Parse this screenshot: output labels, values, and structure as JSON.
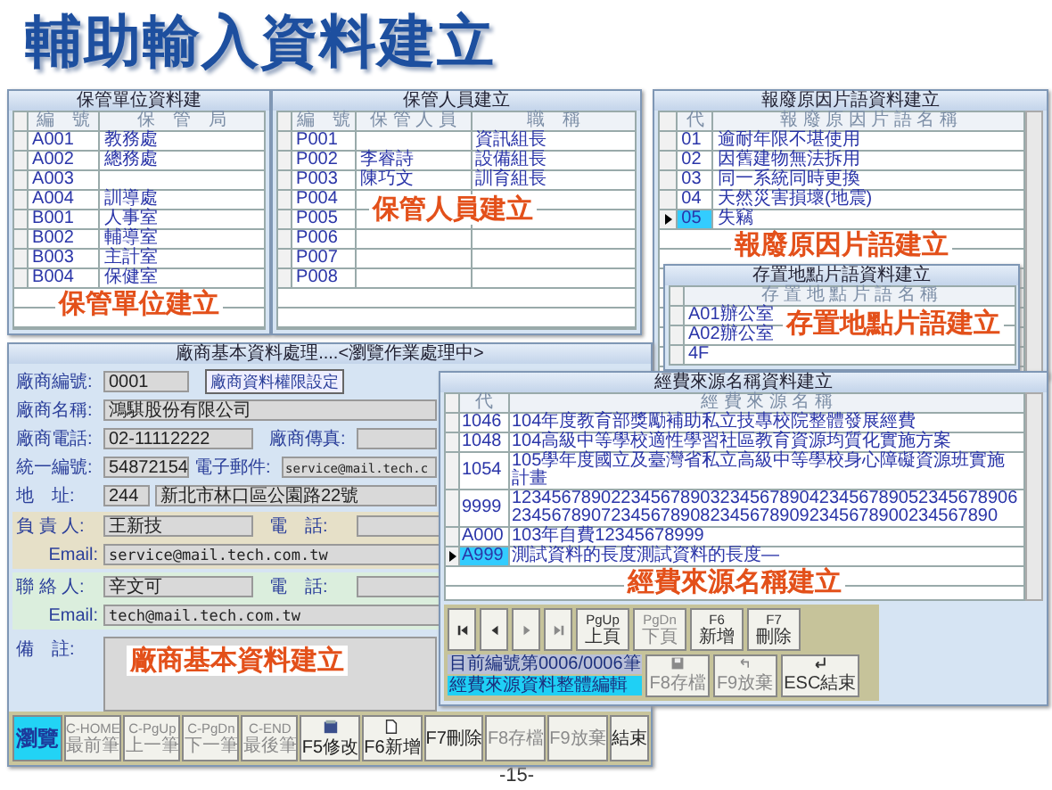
{
  "title": "輔助輸入資料建立",
  "windows": [
    {
      "title": "保管單位資料建",
      "columns": [
        "編　號",
        "保　管　局"
      ],
      "caption": "保管單位建立",
      "rows": [
        {
          "cells": [
            "A001",
            "教務處"
          ],
          "selected": false
        },
        {
          "cells": [
            "A002",
            "總務處"
          ],
          "selected": false
        },
        {
          "cells": [
            "A003"
          ],
          "selected": false
        },
        {
          "cells": [
            "A004",
            "訓導處"
          ],
          "selected": false
        },
        {
          "cells": [
            "B001",
            "人事室"
          ],
          "selected": false
        },
        {
          "cells": [
            "B002",
            "輔導室"
          ],
          "selected": false
        },
        {
          "cells": [
            "B003",
            "主計室"
          ],
          "selected": false
        },
        {
          "cells": [
            "B004",
            "保健室"
          ],
          "selected": false
        }
      ]
    },
    {
      "title": "保管人員建立",
      "columns": [
        "編　號",
        "保 管 人 員",
        "職　稱"
      ],
      "caption": "保管人員建立",
      "rows": [
        {
          "cells": [
            "P001",
            null,
            "資訊組長"
          ],
          "selected": false
        },
        {
          "cells": [
            "P002",
            "李睿詩",
            "設備組長"
          ],
          "selected": false
        },
        {
          "cells": [
            "P003",
            "陳巧文",
            "訓育組長"
          ],
          "selected": false
        },
        {
          "cells": [
            "P004"
          ],
          "selected": false
        },
        {
          "cells": [
            "P005"
          ],
          "selected": false
        },
        {
          "cells": [
            "P006"
          ],
          "selected": false
        },
        {
          "cells": [
            "P007"
          ],
          "selected": false
        },
        {
          "cells": [
            "P008"
          ],
          "selected": false
        }
      ]
    },
    {
      "title": "報廢原因片語資料建立",
      "columns": [
        "代",
        "報 廢 原 因 片 語 名 稱"
      ],
      "caption": "報廢原因片語建立",
      "rows": [
        {
          "cells": [
            "01",
            "逾耐年限不堪使用"
          ],
          "selected": false
        },
        {
          "cells": [
            "02",
            "因舊建物無法拆用"
          ],
          "selected": false
        },
        {
          "cells": [
            "03",
            "同一系統同時更換"
          ],
          "selected": false
        },
        {
          "cells": [
            "04",
            "天然災害損壞(地震)"
          ],
          "selected": false
        },
        {
          "cells": [
            "05",
            "失竊"
          ],
          "selected": true
        }
      ]
    },
    {
      "title": "存置地點片語資料建立",
      "columns": [
        "存 置 地 點 片 語 名 稱"
      ],
      "caption": "存置地點片語建立",
      "rows": [
        {
          "cells": [
            "A01辦公室"
          ],
          "selected": false
        },
        {
          "cells": [
            "A02辦公室"
          ],
          "selected": false
        },
        {
          "cells": [
            "4F"
          ],
          "selected": false
        }
      ]
    }
  ],
  "vendor_form": {
    "title": "廠商基本資料處理....<瀏覽作業處理中>",
    "caption": "廠商基本資料建立",
    "code": {
      "label": "廠商編號:",
      "value": "0001"
    },
    "permission_button": "廠商資料權限設定",
    "name": {
      "label": "廠商名稱:",
      "value": "鴻騏股份有限公司"
    },
    "phone": {
      "label": "廠商電話:",
      "value": "02-11112222"
    },
    "fax": {
      "label": "廠商傳真:"
    },
    "tax_id": {
      "label": "統一編號:",
      "value": "54872154"
    },
    "email": {
      "label": "電子郵件:",
      "value": "service@mail.tech.c"
    },
    "address": {
      "label": "地　址:",
      "zip": "244",
      "value": "新北市林口區公園路22號"
    },
    "owner": {
      "label": "負 責 人:",
      "value": "王新技",
      "phone_label": "電　話:",
      "email_label": "Email:",
      "email": "service@mail.tech.com.tw"
    },
    "contact": {
      "label": "聯 絡 人:",
      "value": "辛文可",
      "phone_label": "電　話:",
      "email_label": "Email:",
      "email": "tech@mail.tech.com.tw"
    },
    "note": {
      "label": "備　註:"
    },
    "buttons": [
      {
        "kind": "mode",
        "label": "瀏覽",
        "selected": true,
        "disabled": false
      },
      {
        "kind": "text",
        "hotkey": "C-HOME",
        "label": "最前筆",
        "selected": false,
        "disabled": true
      },
      {
        "kind": "text",
        "hotkey": "C-PgUp",
        "label": "上一筆",
        "selected": false,
        "disabled": true
      },
      {
        "kind": "text",
        "hotkey": "C-PgDn",
        "label": "下一筆",
        "selected": false,
        "disabled": true
      },
      {
        "kind": "text",
        "hotkey": "C-END",
        "label": "最後筆",
        "selected": false,
        "disabled": true
      },
      {
        "kind": "edit",
        "label": "F5修改",
        "selected": false,
        "disabled": false
      },
      {
        "kind": "new",
        "label": "F6新增",
        "selected": false,
        "disabled": false
      },
      {
        "kind": "plain",
        "label": "F7刪除",
        "selected": false,
        "disabled": false
      },
      {
        "kind": "plain",
        "label": "F8存檔",
        "selected": false,
        "disabled": true
      },
      {
        "kind": "plain",
        "label": "F9放棄",
        "selected": false,
        "disabled": true
      },
      {
        "kind": "plain",
        "label": "結束",
        "selected": false,
        "disabled": false
      }
    ]
  },
  "funding_window": {
    "title": "經費來源名稱資料建立",
    "caption": "經費來源名稱建立",
    "columns": [
      "代",
      "經 費 來 源 名 稱"
    ],
    "rows": [
      {
        "cells": [
          "1046",
          "104年度教育部獎勵補助私立技專校院整體發展經費"
        ],
        "selected": false
      },
      {
        "cells": [
          "1048",
          "104高級中等學校適性學習社區教育資源均質化實施方案"
        ],
        "selected": false
      },
      {
        "cells": [
          "1054",
          "105學年度國立及臺灣省私立高級中等學校身心障礙資源班實施計畫"
        ],
        "selected": false
      },
      {
        "cells": [
          "9999",
          "1234567890223456789032345678904234567890523456789062345678907234567890823456789092345678900234567890"
        ],
        "selected": false
      },
      {
        "cells": [
          "A000",
          "103年自費12345678999"
        ],
        "selected": false
      },
      {
        "cells": [
          "A999",
          "測試資料的長度測試資料的長度—"
        ],
        "selected": true
      }
    ],
    "nav_buttons": [
      {
        "kind": "first",
        "disabled": false
      },
      {
        "kind": "prev",
        "disabled": false
      },
      {
        "kind": "next",
        "disabled": true
      },
      {
        "kind": "last",
        "disabled": true
      },
      {
        "kind": "text",
        "hotkey": "PgUp",
        "label": "上頁",
        "disabled": false
      },
      {
        "kind": "text",
        "hotkey": "PgDn",
        "label": "下頁",
        "disabled": true
      },
      {
        "kind": "text",
        "hotkey": "F6",
        "label": "新增",
        "disabled": false
      },
      {
        "kind": "text",
        "hotkey": "F7",
        "label": "刪除",
        "disabled": false
      }
    ],
    "record_status": "目前編號第0006/0006筆",
    "mode": "經費來源資料整體編輯",
    "action_buttons": [
      {
        "kind": "save",
        "label": "F8存檔",
        "disabled": true
      },
      {
        "kind": "undo",
        "label": "F9放棄",
        "disabled": true
      },
      {
        "kind": "exit",
        "label": "ESC結束",
        "disabled": false
      }
    ]
  },
  "page_number": "-15-"
}
